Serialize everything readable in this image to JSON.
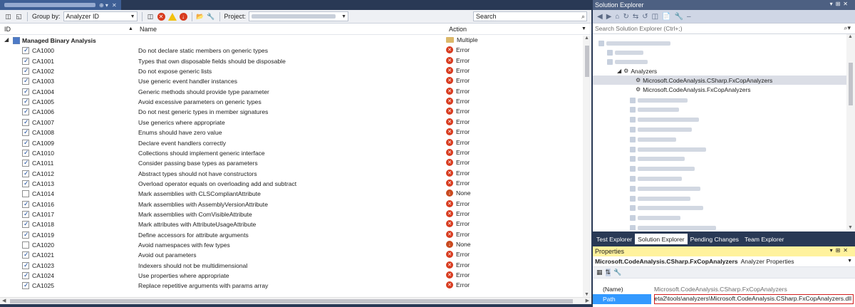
{
  "document_tab": {
    "close_label": "✕",
    "pin_label": "⊕ ▾"
  },
  "toolbar": {
    "group_by_label": "Group by:",
    "group_by_value": "Analyzer ID",
    "project_label": "Project:",
    "search_placeholder": "Search"
  },
  "columns": {
    "id": "ID",
    "name": "Name",
    "action": "Action"
  },
  "group": {
    "name": "Managed Binary Analysis",
    "action": "Multiple"
  },
  "rules": [
    {
      "id": "CA1000",
      "name": "Do not declare static members on generic types",
      "action": "Error",
      "checked": true
    },
    {
      "id": "CA1001",
      "name": "Types that own disposable fields should be disposable",
      "action": "Error",
      "checked": true
    },
    {
      "id": "CA1002",
      "name": "Do not expose generic lists",
      "action": "Error",
      "checked": true
    },
    {
      "id": "CA1003",
      "name": "Use generic event handler instances",
      "action": "Error",
      "checked": true
    },
    {
      "id": "CA1004",
      "name": "Generic methods should provide type parameter",
      "action": "Error",
      "checked": true
    },
    {
      "id": "CA1005",
      "name": "Avoid excessive parameters on generic types",
      "action": "Error",
      "checked": true
    },
    {
      "id": "CA1006",
      "name": "Do not nest generic types in member signatures",
      "action": "Error",
      "checked": true
    },
    {
      "id": "CA1007",
      "name": "Use generics where appropriate",
      "action": "Error",
      "checked": true
    },
    {
      "id": "CA1008",
      "name": "Enums should have zero value",
      "action": "Error",
      "checked": true
    },
    {
      "id": "CA1009",
      "name": "Declare event handlers correctly",
      "action": "Error",
      "checked": true
    },
    {
      "id": "CA1010",
      "name": "Collections should implement generic interface",
      "action": "Error",
      "checked": true
    },
    {
      "id": "CA1011",
      "name": "Consider passing base types as parameters",
      "action": "Error",
      "checked": true
    },
    {
      "id": "CA1012",
      "name": "Abstract types should not have constructors",
      "action": "Error",
      "checked": true
    },
    {
      "id": "CA1013",
      "name": "Overload operator equals on overloading add and subtract",
      "action": "Error",
      "checked": true
    },
    {
      "id": "CA1014",
      "name": "Mark assemblies with CLSCompliantAttribute",
      "action": "None",
      "checked": false
    },
    {
      "id": "CA1016",
      "name": "Mark assemblies with AssemblyVersionAttribute",
      "action": "Error",
      "checked": true
    },
    {
      "id": "CA1017",
      "name": "Mark assemblies with ComVisibleAttribute",
      "action": "Error",
      "checked": true
    },
    {
      "id": "CA1018",
      "name": "Mark attributes with AttributeUsageAttribute",
      "action": "Error",
      "checked": true
    },
    {
      "id": "CA1019",
      "name": "Define accessors for attribute arguments",
      "action": "Error",
      "checked": true
    },
    {
      "id": "CA1020",
      "name": "Avoid namespaces with few types",
      "action": "None",
      "checked": false
    },
    {
      "id": "CA1021",
      "name": "Avoid out parameters",
      "action": "Error",
      "checked": true
    },
    {
      "id": "CA1023",
      "name": "Indexers should not be multidimensional",
      "action": "Error",
      "checked": true
    },
    {
      "id": "CA1024",
      "name": "Use properties where appropriate",
      "action": "Error",
      "checked": true
    },
    {
      "id": "CA1025",
      "name": "Replace repetitive arguments with params array",
      "action": "Error",
      "checked": true
    }
  ],
  "solution_explorer": {
    "title": "Solution Explorer",
    "search_placeholder": "Search Solution Explorer (Ctrl+;)",
    "analyzers_node": "Analyzers",
    "analyzer_items": [
      "Microsoft.CodeAnalysis.CSharp.FxCopAnalyzers",
      "Microsoft.CodeAnalysis.FxCopAnalyzers"
    ],
    "tabs": [
      "Test Explorer",
      "Solution Explorer",
      "Pending Changes",
      "Team Explorer"
    ]
  },
  "properties": {
    "title": "Properties",
    "object_name": "Microsoft.CodeAnalysis.CSharp.FxCopAnalyzers",
    "object_type": "Analyzer Properties",
    "rows": [
      {
        "key": "(Name)",
        "value": "Microsoft.CodeAnalysis.CSharp.FxCopAnalyzers"
      },
      {
        "key": "Path",
        "value": "beta2\\tools\\analyzers\\Microsoft.CodeAnalysis.CSharp.FxCopAnalyzers.dll"
      }
    ]
  }
}
